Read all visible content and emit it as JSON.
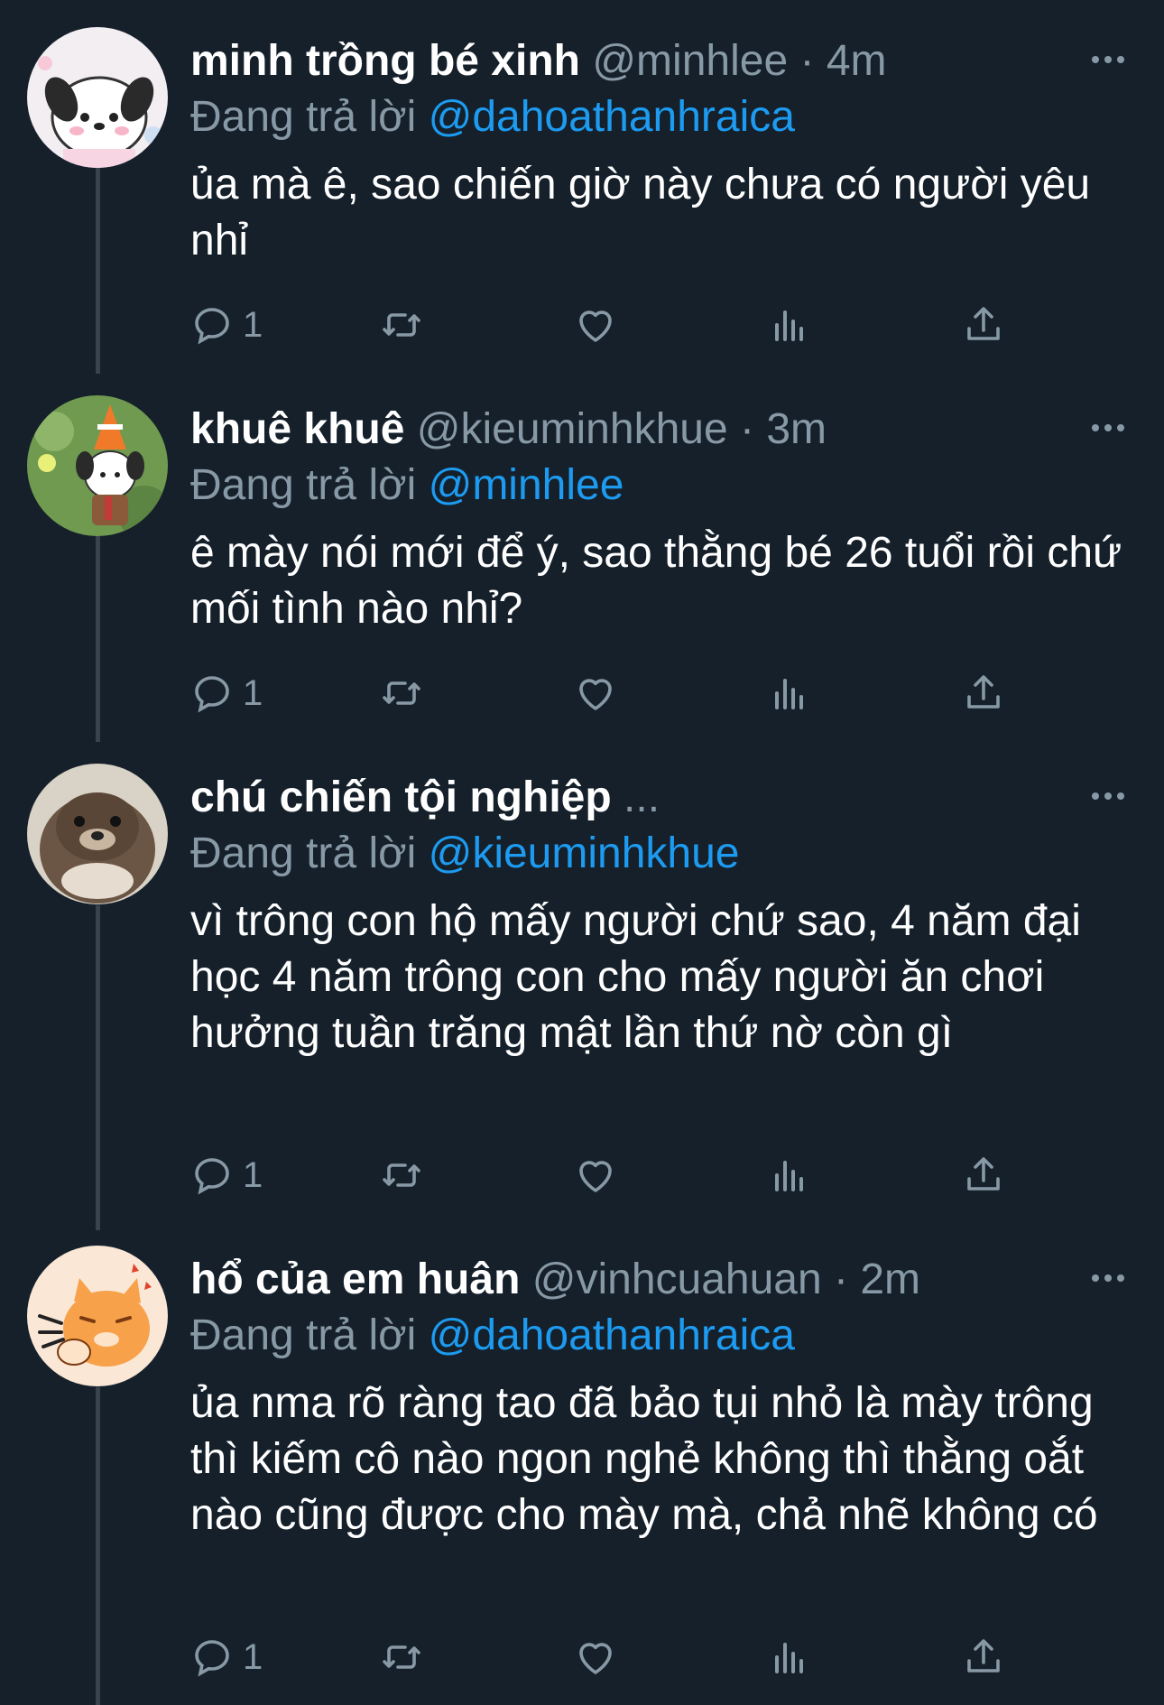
{
  "tweets": [
    {
      "name": "minh trồng bé xinh",
      "handle": "@minhlee",
      "time": "4m",
      "reply_prefix": "Đang trả lời",
      "reply_to": "@dahoathanhraica",
      "text": "ủa mà ê, sao chiến giờ này chưa có người yêu nhỉ",
      "reply_count": "1",
      "avatar": "white-dog-character"
    },
    {
      "name": "khuê khuê",
      "handle": "@kieuminhkhue",
      "time": "3m",
      "reply_prefix": "Đang trả lời",
      "reply_to": "@minhlee",
      "text": "ê mày nói mới để ý, sao thằng bé 26 tuổi rồi chứ mối tình nào nhỉ?",
      "reply_count": "1",
      "avatar": "dog-with-traffic-cone-hat"
    },
    {
      "name": "chú chiến tội nghiệp",
      "handle": "...",
      "time": "",
      "reply_prefix": "Đang trả lời",
      "reply_to": "@kieuminhkhue",
      "text": "vì trông con hộ mấy người chứ sao, 4 năm đại học 4 năm trông con cho mấy người ăn chơi hưởng tuần trăng mật lần thứ nờ còn gì",
      "reply_count": "1",
      "avatar": "otter-photo"
    },
    {
      "name": "hổ của em huân",
      "handle": "@vinhcuahuan",
      "time": "2m",
      "reply_prefix": "Đang trả lời",
      "reply_to": "@dahoathanhraica",
      "text": "ủa nma rõ ràng tao đã bảo tụi nhỏ là mày trông thì kiếm cô nào ngon nghẻ không thì thằng oắt nào cũng được cho mày mà, chả nhẽ không có",
      "reply_count": "1",
      "avatar": "orange-cat-drawing"
    }
  ],
  "colors": {
    "background": "#15202b",
    "secondary_text": "#8899a6",
    "accent": "#1d9bf0",
    "thread_line": "#38444d"
  },
  "icons": [
    "more-icon",
    "reply-icon",
    "retweet-icon",
    "like-icon",
    "analytics-icon",
    "share-icon"
  ]
}
